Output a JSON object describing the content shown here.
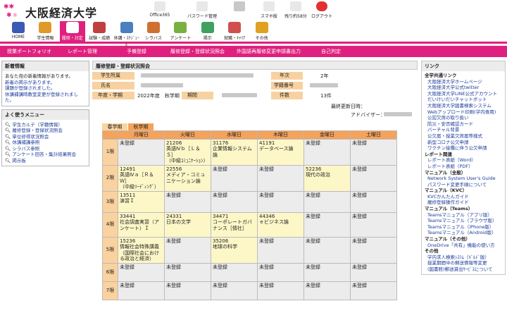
{
  "app": {
    "title": "大阪経済大学"
  },
  "tools": [
    {
      "name": "office365",
      "label": "Office365",
      "icon": "office-icon"
    },
    {
      "name": "password",
      "label": "パスワード管理",
      "icon": "password-icon"
    },
    {
      "name": "user",
      "label": "",
      "icon": "user-icon"
    },
    {
      "name": "smartphone",
      "label": "スマホ版",
      "icon": "phone-icon"
    },
    {
      "name": "remaining",
      "label": "残り約58分",
      "icon": "clock-icon"
    },
    {
      "name": "logout",
      "label": "ログアウト",
      "icon": "logout-icon"
    }
  ],
  "nav": [
    {
      "label": "HOME",
      "icon": "home-icon",
      "color": "#3a5bb5"
    },
    {
      "label": "学生情報",
      "icon": "student-icon",
      "color": "#e09a2a"
    },
    {
      "label": "履修・対定",
      "icon": "course-icon",
      "color": "#fff",
      "active": true
    },
    {
      "label": "試験・成績",
      "icon": "exam-icon",
      "color": "#c04040"
    },
    {
      "label": "休講・ｽｹｼﾞｭｰﾙ",
      "icon": "schedule-icon",
      "color": "#4a7fc0"
    },
    {
      "label": "シラバス",
      "icon": "syllabus-icon",
      "color": "#d07030"
    },
    {
      "label": "アンケート",
      "icon": "survey-icon",
      "color": "#7ab040"
    },
    {
      "label": "掲示",
      "icon": "board-icon",
      "color": "#40a060"
    },
    {
      "label": "就職・ｷｬﾘｱ",
      "icon": "career-icon",
      "color": "#d05050"
    },
    {
      "label": "その他",
      "icon": "other-icon",
      "color": "#e0a020"
    }
  ],
  "subnav": [
    "授業ポートフォリオ",
    "レポート管理",
    "予備登録",
    "履修登録・登録状況照会",
    "外国語再履修変更申請書出力",
    "自己判定"
  ],
  "news": {
    "title": "新着情報",
    "lines": [
      "あなた宛の新着情報があります。",
      "新着の掲示があります。",
      "課題が登録されました。",
      "休講補講時教室変更が登録されました。"
    ]
  },
  "menu": {
    "title": "よく使うメニュー",
    "items": [
      "学生カルテ（学籍情報）",
      "履修登録・登録状況照会",
      "単位修得状況照会",
      "休講補講参照",
      "シラバス参照",
      "アンケート回答・集計結果照会",
      "掲示板"
    ]
  },
  "main": {
    "heading": "履修登録・登録状況照会",
    "labels": {
      "dept": "学生所属",
      "grade_l": "年次",
      "name": "氏名",
      "id": "学籍番号",
      "year": "年度・学期",
      "period": "期間",
      "count_l": "件数"
    },
    "grade": "2年",
    "yearval": "2022年度　秋学期",
    "count": "13件",
    "updated": "最終更新日時：",
    "advisor": "アドバイザー：",
    "tabs": [
      "春学期",
      "秋学期"
    ]
  },
  "timetable": {
    "days": [
      "",
      "月曜日",
      "火曜日",
      "水曜日",
      "木曜日",
      "金曜日",
      "土曜日"
    ],
    "rows": [
      {
        "p": "1限",
        "c": [
          [
            "未登録",
            "g"
          ],
          [
            "21206\n英語Ⅳｂ［Ｌ＆Ｓ］\n（中級ｺﾐｭﾆｹｰｼｮﾝ）",
            "y"
          ],
          [
            "31176\n企業情報システム論",
            "y"
          ],
          [
            "41191\nデータベース論",
            "y"
          ],
          [
            "未登録",
            "g"
          ],
          [
            "未登録",
            "g"
          ]
        ]
      },
      {
        "p": "2限",
        "c": [
          [
            "12491\n英語Ⅳａ［Ｒ＆Ｗ］\n（中級ﾘｰﾃﾞｨﾝｸﾞ）",
            "y"
          ],
          [
            "22556\nメディア・コミュニケーション論",
            "y"
          ],
          [
            "未登録",
            "g"
          ],
          [
            "未登録",
            "g"
          ],
          [
            "52236\n現代の政治",
            "y"
          ],
          [
            "未登録",
            "g"
          ]
        ]
      },
      {
        "p": "3限",
        "c": [
          [
            "13511\n演習Ｉ",
            "y"
          ],
          [
            "未登録",
            "g"
          ],
          [
            "未登録",
            "g"
          ],
          [
            "未登録",
            "g"
          ],
          [
            "未登録",
            "g"
          ],
          [
            "未登録",
            "g"
          ]
        ]
      },
      {
        "p": "4限",
        "c": [
          [
            "33441\n社会調査実習（アンケート）Ｉ",
            "y"
          ],
          [
            "24331\n日本の文学",
            "y"
          ],
          [
            "34471\nコーポレートガバナンス［情社］",
            "y"
          ],
          [
            "44346\nｅビジネス論",
            "y"
          ],
          [
            "未登録",
            "g"
          ],
          [
            "未登録",
            "g"
          ]
        ]
      },
      {
        "p": "5限",
        "c": [
          [
            "15236\n情報社会特殊講義（国際社会における政治と経済）",
            "y"
          ],
          [
            "未登録",
            "g"
          ],
          [
            "35206\n地球の科学",
            "y"
          ],
          [
            "未登録",
            "g"
          ],
          [
            "未登録",
            "g"
          ],
          [
            "未登録",
            "g"
          ]
        ]
      },
      {
        "p": "6限",
        "c": [
          [
            "未登録",
            "g"
          ],
          [
            "未登録",
            "g"
          ],
          [
            "未登録",
            "g"
          ],
          [
            "未登録",
            "g"
          ],
          [
            "未登録",
            "g"
          ],
          [
            "未登録",
            "g"
          ]
        ]
      },
      {
        "p": "7限",
        "c": [
          [
            "未登録",
            "g"
          ],
          [
            "未登録",
            "g"
          ],
          [
            "未登録",
            "g"
          ],
          [
            "未登録",
            "g"
          ],
          [
            "未登録",
            "g"
          ],
          [
            "未登録",
            "g"
          ]
        ]
      }
    ]
  },
  "links": {
    "title": "リンク",
    "groups": [
      {
        "name": "全学共通リンク",
        "items": [
          "大阪経済大学ホームページ",
          "大阪経済大学公式twitter",
          "大阪経済大学LINE公式アカウント",
          "だいけいだいチャットボット",
          "大阪経済大学図書検索システム",
          "Webアップロード印刷(学内専用)",
          "公認欠席の取り扱い",
          "防災・安否確認カード",
          "バーチャル背景",
          "公欠届・授業欠席届等様式",
          "新型コロナ公欠申請",
          "ワクチン接種に伴う公欠申請"
        ]
      },
      {
        "name": "レポート関連",
        "items": [
          "レポート表紙（Word）",
          "レポート表紙（PDF）"
        ]
      },
      {
        "name": "マニュアル（全般）",
        "items": [
          "Network System User's Guide",
          "パスワード変更手順について"
        ]
      },
      {
        "name": "マニュアル（KVC）",
        "items": [
          "KVCかんたんガイド",
          "履修登録操作ガイド"
        ]
      },
      {
        "name": "マニュアル（Teams）",
        "items": [
          "Teamsマニュアル（アプリ版）",
          "Teamsマニュアル（ブラウザ版）",
          "Teamsマニュアル（iPhone版）",
          "Teamsマニュアル（Android版）"
        ]
      },
      {
        "name": "マニュアル（その他）",
        "items": [
          "OneDrive「共有」機能の使い方"
        ]
      },
      {
        "name": "その他",
        "items": [
          "学内求人検索ｼｽﾃﾑ（ｷﾞﾙﾄﾞ版）",
          "授業期間中の郵送情報等変更",
          "(図書館)郵送貸出ｻｰﾋﾞｽについて"
        ]
      }
    ]
  }
}
